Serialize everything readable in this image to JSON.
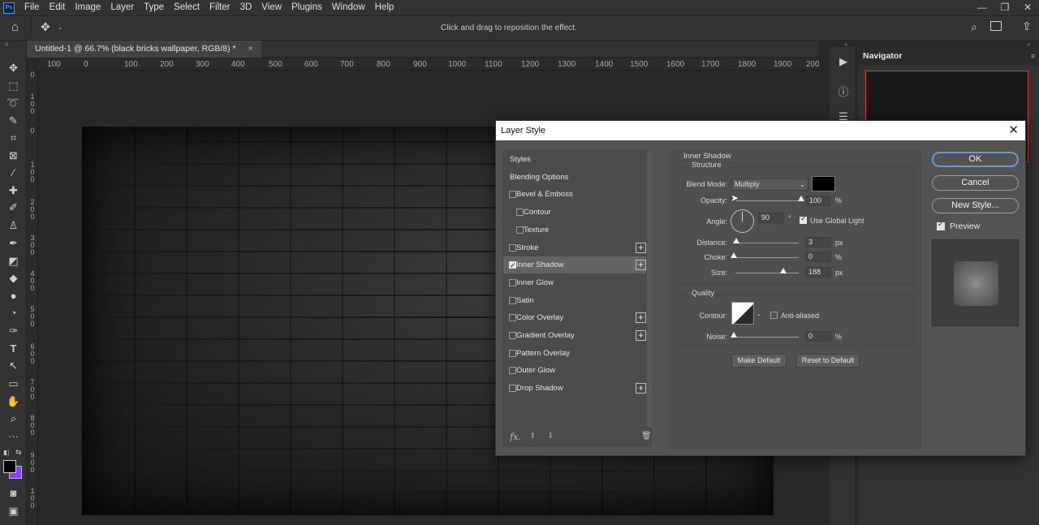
{
  "app": {
    "logo": "Ps",
    "menu": [
      "File",
      "Edit",
      "Image",
      "Layer",
      "Type",
      "Select",
      "Filter",
      "3D",
      "View",
      "Plugins",
      "Window",
      "Help"
    ],
    "window_controls": [
      "—",
      "❐",
      "✕"
    ]
  },
  "options_bar": {
    "hint": "Click and drag to reposition the effect."
  },
  "document": {
    "tab_title": "Untitled-1 @ 66.7% (black bricks wallpaper, RGB/8) *",
    "close": "×",
    "ruler_h_labels": [
      "100",
      "0",
      "100",
      "200",
      "300",
      "400",
      "500",
      "600",
      "700",
      "800",
      "900",
      "1000",
      "1100",
      "1200",
      "1300",
      "1400",
      "1500",
      "1600",
      "1700",
      "1800",
      "1900",
      "200"
    ],
    "ruler_v_labels": [
      "0",
      "1\n0\n0",
      "0",
      "1\n0\n0",
      "2\n0\n0",
      "3\n0\n0",
      "4\n0\n0",
      "5\n0\n0",
      "6\n0\n0",
      "7\n0\n0",
      "8\n0\n0",
      "9\n0\n0",
      "1\n0\n0"
    ]
  },
  "navigator": {
    "title": "Navigator"
  },
  "dialog": {
    "title": "Layer Style",
    "close": "✕",
    "styles_list": [
      {
        "label": "Styles",
        "checkbox": false,
        "indent": 0,
        "plus": false,
        "selected": false,
        "checked": false
      },
      {
        "label": "Blending Options",
        "checkbox": false,
        "indent": 0,
        "plus": false,
        "selected": false,
        "checked": false
      },
      {
        "label": "Bevel & Emboss",
        "checkbox": true,
        "indent": 0,
        "plus": false,
        "selected": false,
        "checked": false
      },
      {
        "label": "Contour",
        "checkbox": true,
        "indent": 1,
        "plus": false,
        "selected": false,
        "checked": false
      },
      {
        "label": "Texture",
        "checkbox": true,
        "indent": 1,
        "plus": false,
        "selected": false,
        "checked": false
      },
      {
        "label": "Stroke",
        "checkbox": true,
        "indent": 0,
        "plus": true,
        "selected": false,
        "checked": false
      },
      {
        "label": "Inner Shadow",
        "checkbox": true,
        "indent": 0,
        "plus": true,
        "selected": true,
        "checked": true
      },
      {
        "label": "Inner Glow",
        "checkbox": true,
        "indent": 0,
        "plus": false,
        "selected": false,
        "checked": false
      },
      {
        "label": "Satin",
        "checkbox": true,
        "indent": 0,
        "plus": false,
        "selected": false,
        "checked": false
      },
      {
        "label": "Color Overlay",
        "checkbox": true,
        "indent": 0,
        "plus": true,
        "selected": false,
        "checked": false
      },
      {
        "label": "Gradient Overlay",
        "checkbox": true,
        "indent": 0,
        "plus": true,
        "selected": false,
        "checked": false
      },
      {
        "label": "Pattern Overlay",
        "checkbox": true,
        "indent": 0,
        "plus": false,
        "selected": false,
        "checked": false
      },
      {
        "label": "Outer Glow",
        "checkbox": true,
        "indent": 0,
        "plus": false,
        "selected": false,
        "checked": false
      },
      {
        "label": "Drop Shadow",
        "checkbox": true,
        "indent": 0,
        "plus": true,
        "selected": false,
        "checked": false
      }
    ],
    "list_footer": {
      "fx": "fx.",
      "up": "⬆",
      "down": "⬇",
      "trash": "🗑"
    },
    "panel_title": "Inner Shadow",
    "structure": {
      "title": "Structure",
      "blend_mode_label": "Blend Mode:",
      "blend_mode_value": "Multiply",
      "shadow_color": "#000000",
      "opacity_label": "Opacity:",
      "opacity_value": "100",
      "opacity_unit": "%",
      "opacity_level": 1.0,
      "angle_label": "Angle:",
      "angle_value": "90",
      "angle_unit": "°",
      "global_light_label": "Use Global Light",
      "global_light_checked": true,
      "distance_label": "Distance:",
      "distance_value": "3",
      "distance_unit": "px",
      "distance_level": 0.015,
      "choke_label": "Choke:",
      "choke_value": "0",
      "choke_unit": "%",
      "choke_level": 0.0,
      "size_label": "Size:",
      "size_value": "188",
      "size_unit": "px",
      "size_level": 0.75
    },
    "quality": {
      "title": "Quality",
      "contour_label": "Contour:",
      "anti_aliased_label": "Anti-aliased",
      "anti_aliased_checked": false,
      "noise_label": "Noise:",
      "noise_value": "0",
      "noise_unit": "%",
      "noise_level": 0.0
    },
    "make_default": "Make Default",
    "reset_default": "Reset to Default",
    "buttons": {
      "ok": "OK",
      "cancel": "Cancel",
      "new_style": "New Style..."
    },
    "preview_label": "Preview",
    "preview_checked": true
  }
}
